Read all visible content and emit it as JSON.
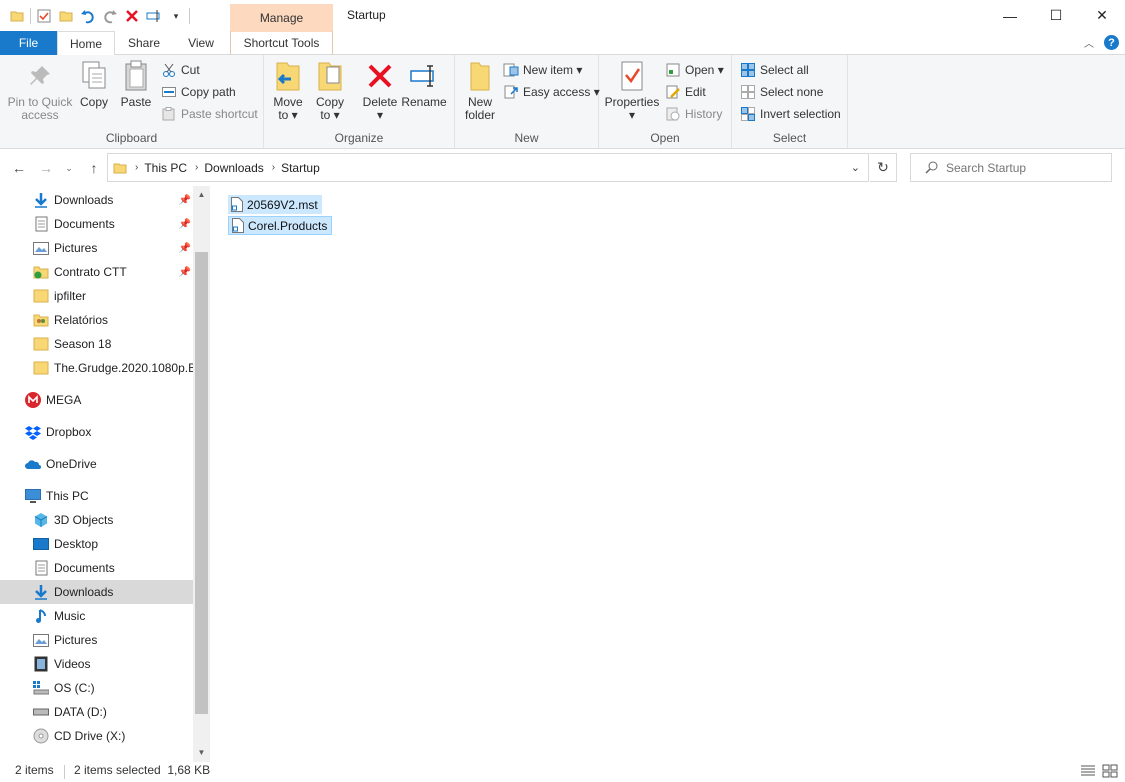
{
  "window": {
    "title": "Startup",
    "contextual_tab_header": "Manage",
    "minimize": "—",
    "maximize": "☐",
    "close": "✕"
  },
  "ribbon_tabs": {
    "file": "File",
    "home": "Home",
    "share": "Share",
    "view": "View",
    "shortcut_tools": "Shortcut Tools"
  },
  "clipboard": {
    "label": "Clipboard",
    "pin_line1": "Pin to Quick",
    "pin_line2": "access",
    "copy": "Copy",
    "paste": "Paste",
    "cut": "Cut",
    "copy_path": "Copy path",
    "paste_shortcut": "Paste shortcut"
  },
  "organize": {
    "label": "Organize",
    "move_line1": "Move",
    "move_line2": "to ▾",
    "copy_line1": "Copy",
    "copy_line2": "to ▾",
    "delete_line1": "Delete",
    "delete_line2": "▾",
    "rename": "Rename"
  },
  "new_group": {
    "label": "New",
    "new_folder_line1": "New",
    "new_folder_line2": "folder",
    "new_item": "New item ▾",
    "easy_access": "Easy access ▾"
  },
  "open_group": {
    "label": "Open",
    "properties_line1": "Properties",
    "properties_line2": "▾",
    "open": "Open ▾",
    "edit": "Edit",
    "history": "History"
  },
  "select_group": {
    "label": "Select",
    "select_all": "Select all",
    "select_none": "Select none",
    "invert_selection": "Invert selection"
  },
  "address": {
    "crumbs": [
      "This PC",
      "Downloads",
      "Startup"
    ],
    "search_placeholder": "Search Startup"
  },
  "nav_pane": {
    "quick_access": [
      {
        "label": "Downloads",
        "icon": "download-arrow-icon",
        "pinned": true
      },
      {
        "label": "Documents",
        "icon": "document-icon",
        "pinned": true
      },
      {
        "label": "Pictures",
        "icon": "pictures-icon",
        "pinned": true
      },
      {
        "label": "Contrato CTT",
        "icon": "folder-sync-icon",
        "pinned": true
      },
      {
        "label": "ipfilter",
        "icon": "folder-icon",
        "pinned": false
      },
      {
        "label": "Relatórios",
        "icon": "folder-people-icon",
        "pinned": false
      },
      {
        "label": "Season 18",
        "icon": "folder-icon",
        "pinned": false
      },
      {
        "label": "The.Grudge.2020.1080p.Blu",
        "icon": "folder-icon",
        "pinned": false
      }
    ],
    "mega": "MEGA",
    "dropbox": "Dropbox",
    "onedrive": "OneDrive",
    "this_pc": "This PC",
    "this_pc_items": [
      {
        "label": "3D Objects",
        "icon": "3d-objects-icon"
      },
      {
        "label": "Desktop",
        "icon": "desktop-icon"
      },
      {
        "label": "Documents",
        "icon": "document-icon"
      },
      {
        "label": "Downloads",
        "icon": "download-arrow-icon",
        "selected": true
      },
      {
        "label": "Music",
        "icon": "music-note-icon"
      },
      {
        "label": "Pictures",
        "icon": "pictures-icon"
      },
      {
        "label": "Videos",
        "icon": "videos-icon"
      },
      {
        "label": "OS (C:)",
        "icon": "drive-os-icon"
      },
      {
        "label": "DATA (D:)",
        "icon": "drive-icon"
      },
      {
        "label": "CD Drive (X:)",
        "icon": "cd-drive-icon"
      }
    ]
  },
  "files": [
    {
      "name": "20569V2.mst",
      "icon": "shortcut-file-icon",
      "selected": true
    },
    {
      "name": "Corel.Products",
      "icon": "shortcut-file-icon",
      "selected": true,
      "focused": true
    }
  ],
  "status": {
    "count": "2 items",
    "selection": "2 items selected  1,68 KB"
  },
  "colors": {
    "accent": "#1979ca",
    "manage_tab": "#fcd9bf",
    "selection": "#cce8ff",
    "delete_red": "#e81123"
  }
}
